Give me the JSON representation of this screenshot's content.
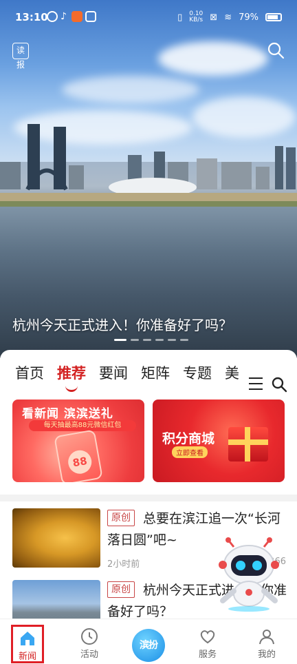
{
  "status_bar": {
    "time": "13:10",
    "net_speed": "0.10\nKB/s",
    "battery": "79%"
  },
  "hero": {
    "read_label": "读报",
    "title": "杭州今天正式进入！你准备好了吗？",
    "slides": 6,
    "active_slide": 0
  },
  "tabs": [
    {
      "label": "首页",
      "active": false
    },
    {
      "label": "推荐",
      "active": true
    },
    {
      "label": "要闻",
      "active": false
    },
    {
      "label": "矩阵",
      "active": false
    },
    {
      "label": "专题",
      "active": false
    },
    {
      "label": "美",
      "active": false
    }
  ],
  "banners": {
    "left": {
      "title": "看新闻 滨滨送礼",
      "subtitle": "每天抽最高88元微信红包",
      "amount": "88"
    },
    "right": {
      "title": "积分商城",
      "button": "立即查看"
    }
  },
  "news": [
    {
      "tag": "原创",
      "title": "总要在滨江追一次“长河落日圆”吧~",
      "time": "2小时前",
      "count": "266"
    },
    {
      "tag": "原创",
      "title": "杭州今天正式进入！你准备好了吗？",
      "time": "",
      "count": ""
    }
  ],
  "bottom_nav": {
    "items": [
      {
        "label": "新闻",
        "icon": "home-icon",
        "active": true
      },
      {
        "label": "活动",
        "icon": "clock-icon",
        "active": false
      },
      {
        "label": "滨扮",
        "icon": "center-logo",
        "active": false
      },
      {
        "label": "服务",
        "icon": "heart-icon",
        "active": false
      },
      {
        "label": "我的",
        "icon": "user-icon",
        "active": false
      }
    ]
  },
  "colors": {
    "accent": "#d32121",
    "tag_border": "#c84444",
    "center_button": "#1b8fe6"
  }
}
